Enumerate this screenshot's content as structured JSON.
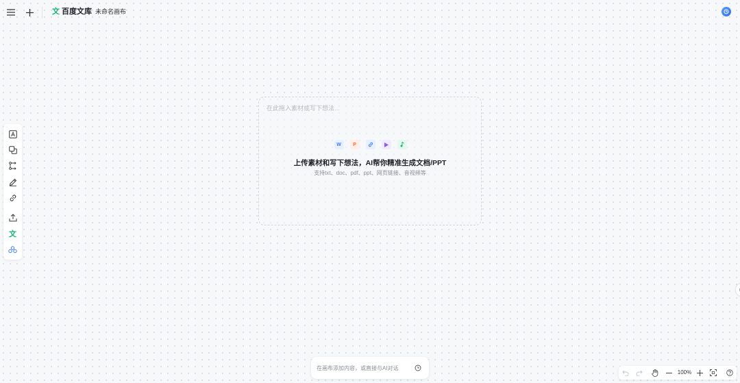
{
  "header": {
    "brand_glyph": "文",
    "brand_name": "百度文库",
    "document_title": "未命名画布",
    "menu_icon": "hamburger-menu-icon",
    "add_icon": "plus-icon",
    "avatar_icon": "user-avatar-icon"
  },
  "left_toolbar": {
    "tools": [
      {
        "name": "text-box-icon"
      },
      {
        "name": "shapes-icon"
      },
      {
        "name": "flow-connector-icon"
      },
      {
        "name": "pen-icon"
      },
      {
        "name": "link-icon"
      },
      {
        "name": "upload-icon"
      },
      {
        "name": "wenku-doc-icon",
        "glyph": "文"
      },
      {
        "name": "plugins-icon"
      }
    ]
  },
  "drop_area": {
    "placeholder": "在此拖入素材或写下想法...",
    "file_types": [
      {
        "label": "W",
        "name": "word-file-icon",
        "color": "#3b7bf6",
        "bg": "#e8f0ff"
      },
      {
        "label": "P",
        "name": "ppt-file-icon",
        "color": "#f26d3d",
        "bg": "#ffefe8"
      },
      {
        "label": "",
        "name": "link-file-icon",
        "color": "#3b7bf6",
        "bg": "#e8f0ff"
      },
      {
        "label": "",
        "name": "video-file-icon",
        "color": "#8a5cf6",
        "bg": "#f1ebff"
      },
      {
        "label": "",
        "name": "audio-file-icon",
        "color": "#18b57a",
        "bg": "#e6f7f0"
      }
    ],
    "headline": "上传素材和写下想法，AI帮你精准生成文档/PPT",
    "supported": "支持txt、doc、pdf、ppt、网页链接、音视频等"
  },
  "chat": {
    "placeholder": "在画布添加内容，或直接与AI对话",
    "history_icon": "history-clock-icon"
  },
  "zoom_bar": {
    "zoom_level": "100%",
    "undo_icon": "undo-icon",
    "redo_icon": "redo-icon",
    "hand_icon": "hand-pan-icon",
    "zoom_out_icon": "minus-icon",
    "zoom_in_icon": "plus-icon",
    "fit_icon": "fit-screen-icon",
    "help_icon": "help-icon"
  },
  "colors": {
    "brand_green": "#18b57a",
    "accent_blue": "#2f6ff0"
  }
}
